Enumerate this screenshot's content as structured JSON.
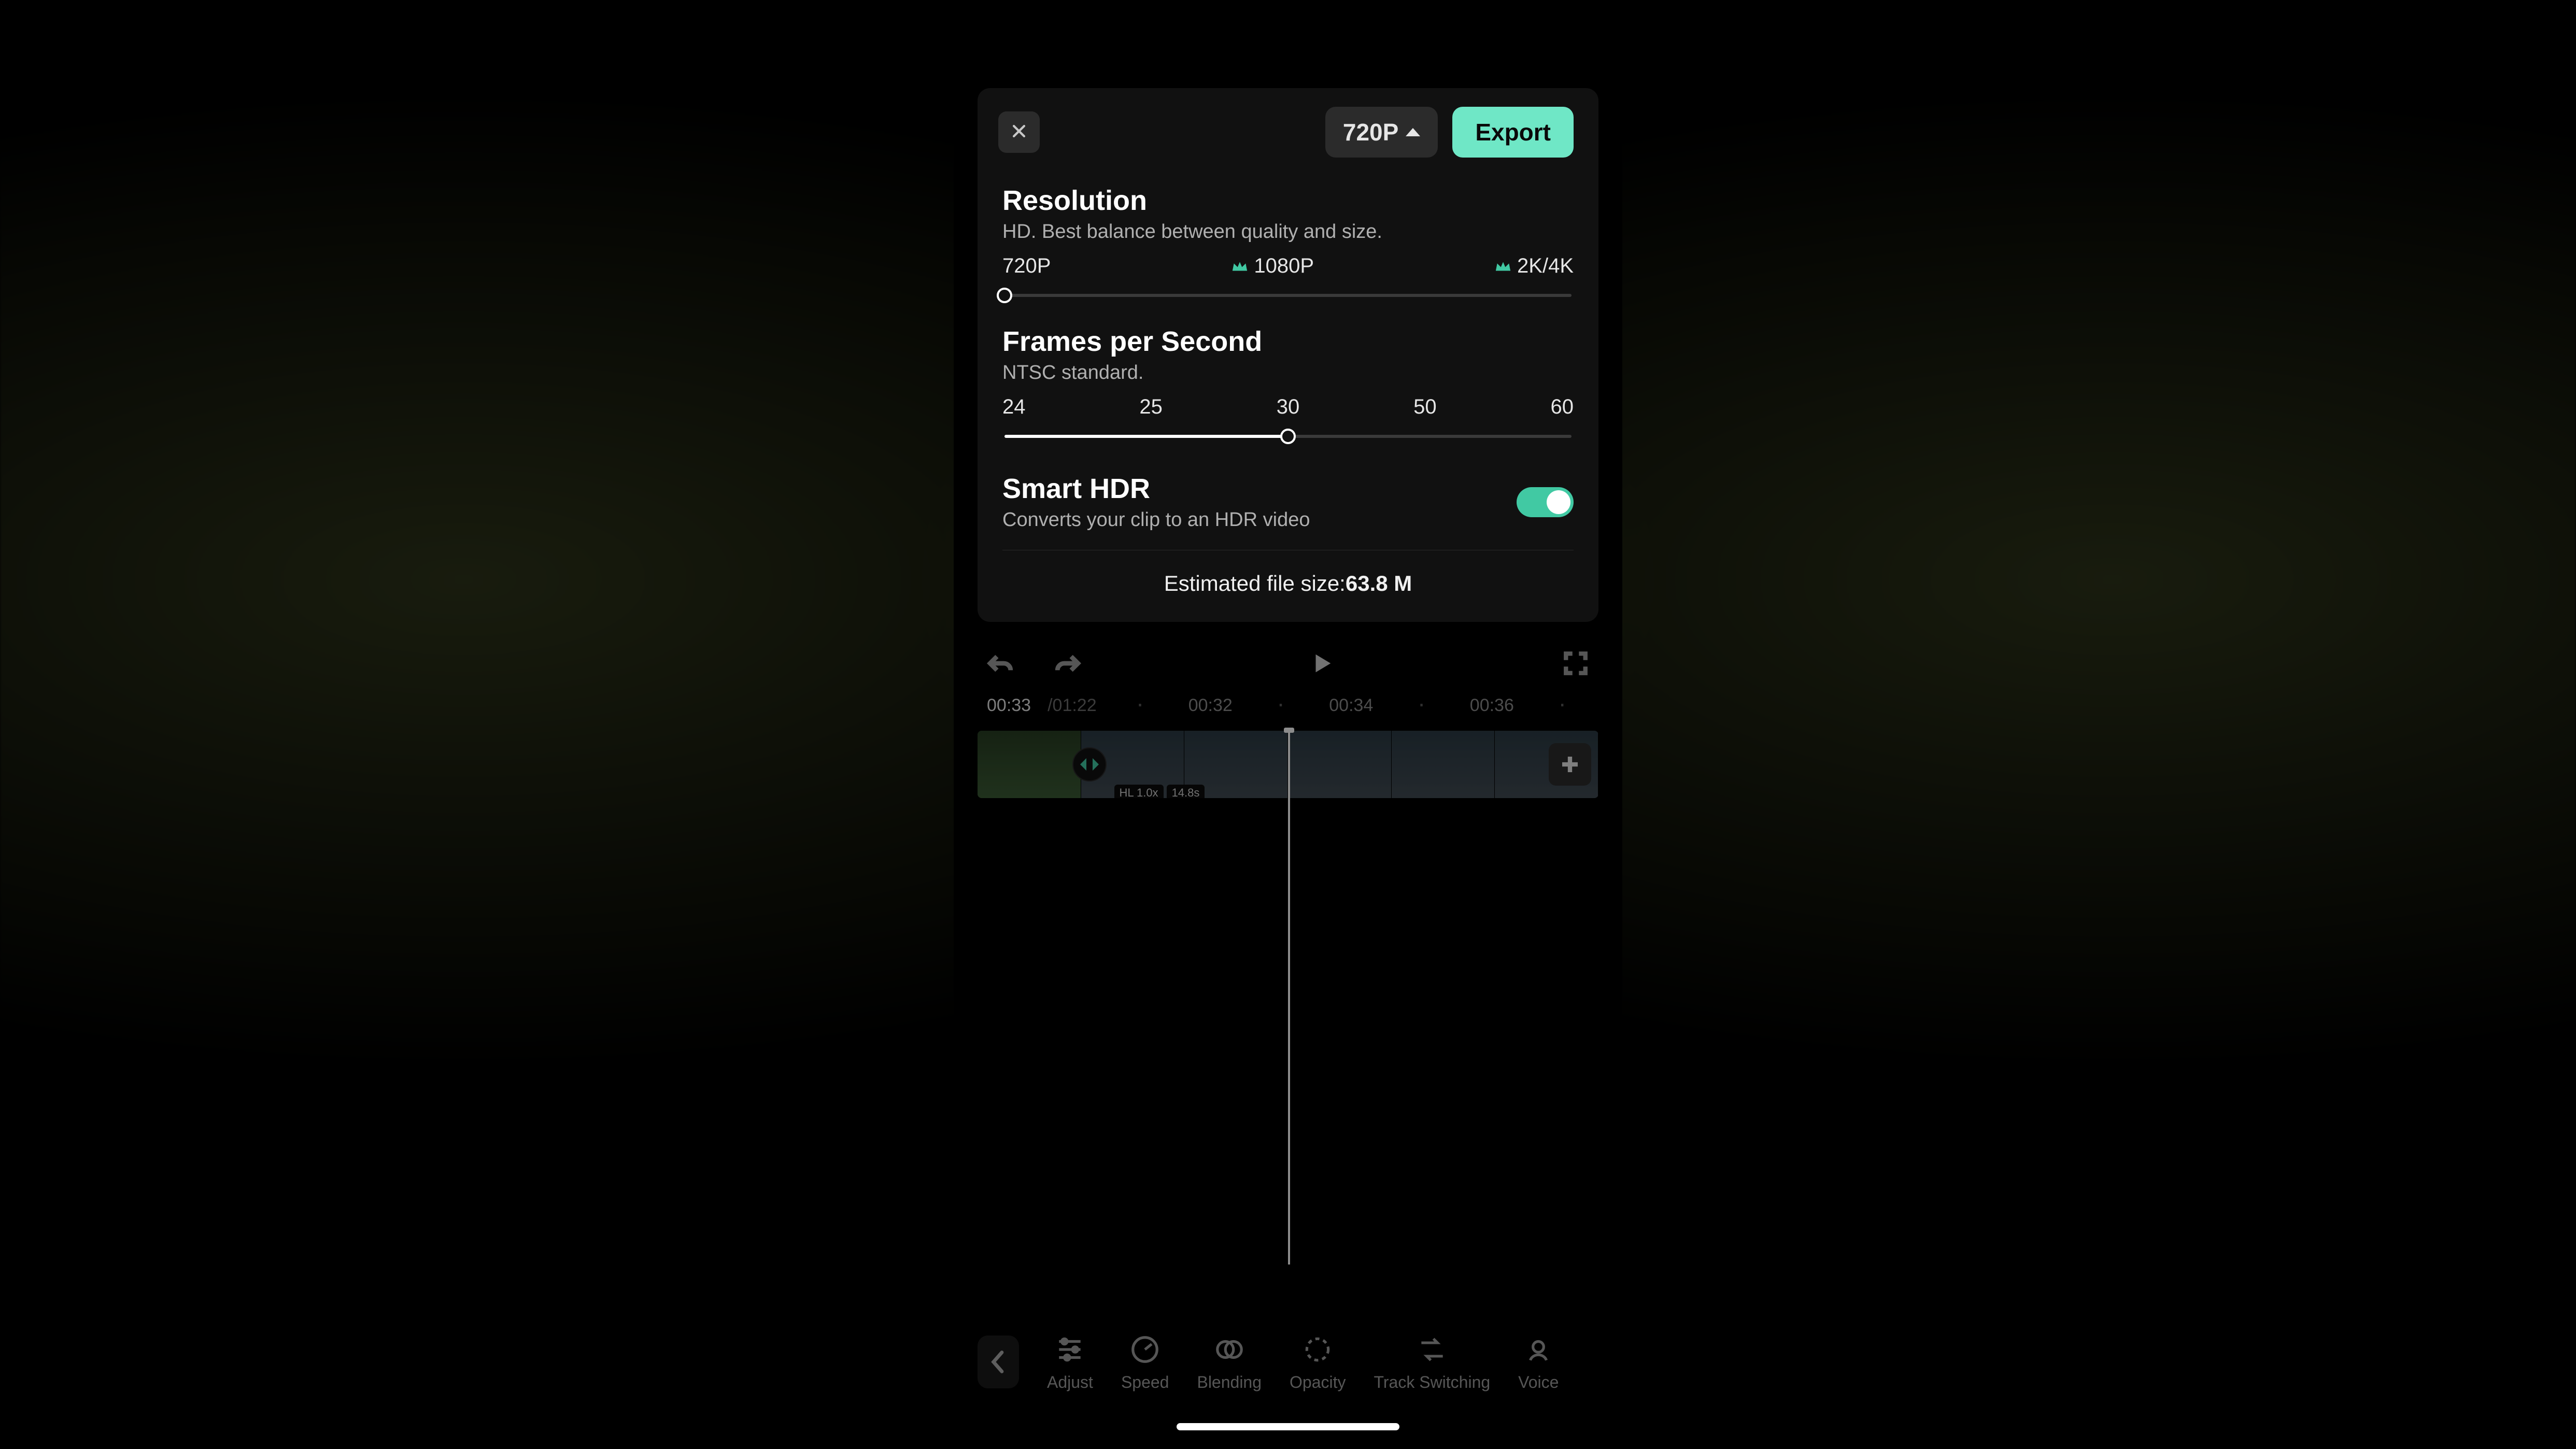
{
  "colors": {
    "accent": "#6FE7C6",
    "accent_dark": "#41C9A3",
    "panel": "#111111",
    "chip": "#2b2b2b"
  },
  "header": {
    "resolution_chip": "720P",
    "export_label": "Export"
  },
  "resolution": {
    "title": "Resolution",
    "subtitle": "HD. Best balance between quality and size.",
    "options": [
      "720P",
      "1080P",
      "2K/4K"
    ],
    "premium_flags": [
      false,
      true,
      true
    ],
    "selected_index": 0
  },
  "fps": {
    "title": "Frames per Second",
    "subtitle": "NTSC standard.",
    "options": [
      "24",
      "25",
      "30",
      "50",
      "60"
    ],
    "selected_index": 2
  },
  "hdr": {
    "title": "Smart HDR",
    "subtitle": "Converts your clip to an HDR video",
    "enabled": true
  },
  "estimate": {
    "label": "Estimated file size:",
    "value": "63.8 M"
  },
  "editor": {
    "time_current": "00:33",
    "time_total": "01:22",
    "ruler": [
      "00:32",
      "00:34",
      "00:36"
    ],
    "clip_chips": [
      "HL 1.0x",
      "14.8s"
    ]
  },
  "toolstrip": {
    "items": [
      "Adjust",
      "Speed",
      "Blending",
      "Opacity",
      "Track Switching",
      "Voice"
    ]
  }
}
